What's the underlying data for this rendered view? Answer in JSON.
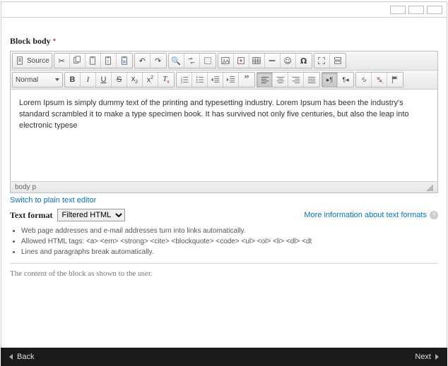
{
  "field": {
    "label": "Block body",
    "required_marker": "*"
  },
  "toolbar": {
    "source_label": "Source",
    "format_select": "Normal"
  },
  "editor": {
    "content": "Lorem Ipsum is simply dummy text of the printing and typesetting industry. Lorem Ipsum has been the industry's standard scrambled it to make a type specimen book. It has survived not only five centuries, but also the leap into electronic typese",
    "path": "body   p"
  },
  "links": {
    "switch": "Switch to plain text editor",
    "more_info": "More information about text formats"
  },
  "format": {
    "label": "Text format",
    "selected": "Filtered HTML",
    "options": [
      "Filtered HTML"
    ]
  },
  "tips": [
    "Web page addresses and e-mail addresses turn into links automatically.",
    "Allowed HTML tags: <a> <em> <strong> <cite> <blockquote> <code> <ul> <ol> <li> <dl> <dt",
    "Lines and paragraphs break automatically."
  ],
  "description": "The content of the block as shown to the user.",
  "footer": {
    "back": "Back",
    "next": "Next"
  }
}
